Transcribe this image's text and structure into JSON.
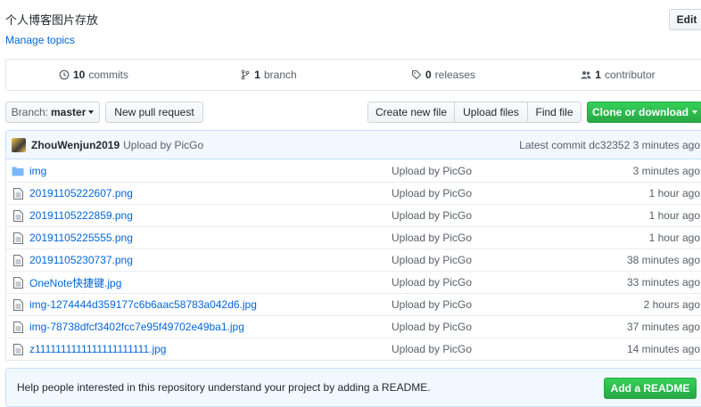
{
  "repo": {
    "description": "个人博客图片存放",
    "manage_topics": "Manage topics",
    "edit_label": "Edit"
  },
  "numbers": {
    "commits_count": "10",
    "commits_label": "commits",
    "branch_count": "1",
    "branch_label": "branch",
    "releases_count": "0",
    "releases_label": "releases",
    "contributors_count": "1",
    "contributors_label": "contributor"
  },
  "toolbar": {
    "branch_prefix": "Branch:",
    "branch_name": "master",
    "new_pr": "New pull request",
    "create_file": "Create new file",
    "upload_files": "Upload files",
    "find_file": "Find file",
    "clone": "Clone or download"
  },
  "commit": {
    "author": "ZhouWenjun2019",
    "message": "Upload by PicGo",
    "latest_prefix": "Latest commit",
    "sha": "dc32352",
    "age": "3 minutes ago"
  },
  "files": [
    {
      "name": "img",
      "type": "folder",
      "message": "Upload by PicGo",
      "age": "3 minutes ago"
    },
    {
      "name": "20191105222607.png",
      "type": "file",
      "message": "Upload by PicGo",
      "age": "1 hour ago"
    },
    {
      "name": "20191105222859.png",
      "type": "file",
      "message": "Upload by PicGo",
      "age": "1 hour ago"
    },
    {
      "name": "20191105225555.png",
      "type": "file",
      "message": "Upload by PicGo",
      "age": "1 hour ago"
    },
    {
      "name": "20191105230737.png",
      "type": "file",
      "message": "Upload by PicGo",
      "age": "38 minutes ago"
    },
    {
      "name": "OneNote快捷键.jpg",
      "type": "file",
      "message": "Upload by PicGo",
      "age": "33 minutes ago"
    },
    {
      "name": "img-1274444d359177c6b6aac58783a042d6.jpg",
      "type": "file",
      "message": "Upload by PicGo",
      "age": "2 hours ago"
    },
    {
      "name": "img-78738dfcf3402fcc7e95f49702e49ba1.jpg",
      "type": "file",
      "message": "Upload by PicGo",
      "age": "37 minutes ago"
    },
    {
      "name": "z1111111111111111111111.jpg",
      "type": "file",
      "message": "Upload by PicGo",
      "age": "14 minutes ago"
    }
  ],
  "readme": {
    "text": "Help people interested in this repository understand your project by adding a README.",
    "button": "Add a README"
  },
  "colors": {
    "link": "#0366d6",
    "green": "#28a745",
    "folder": "#79b8ff",
    "muted": "#586069"
  }
}
